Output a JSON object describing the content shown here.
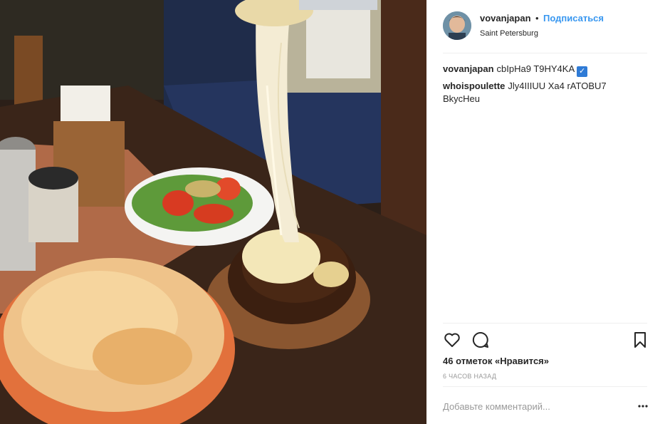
{
  "post": {
    "username": "vovanjapan",
    "separator": "•",
    "follow_label": "Подписаться",
    "location": "Saint Petersburg"
  },
  "comments": [
    {
      "user": "vovanjapan",
      "text": "cbIpHa9 T9HY4KA",
      "verified_emoji": "✓"
    },
    {
      "user": "whoispoulette",
      "text": "Jly4IIIUU Xa4 rATOBU7 BkycHeu"
    }
  ],
  "actions": {
    "like_icon": "heart-outline-icon",
    "comment_icon": "speech-bubble-icon",
    "save_icon": "bookmark-icon"
  },
  "likes_text": "46 отметок «Нравится»",
  "time_text": "6 ЧАСОВ НАЗАД",
  "add_comment_placeholder": "Добавьте комментарий...",
  "colors": {
    "follow_blue": "#3897f0",
    "text": "#262626",
    "muted": "#999999",
    "divider": "#efefef"
  }
}
